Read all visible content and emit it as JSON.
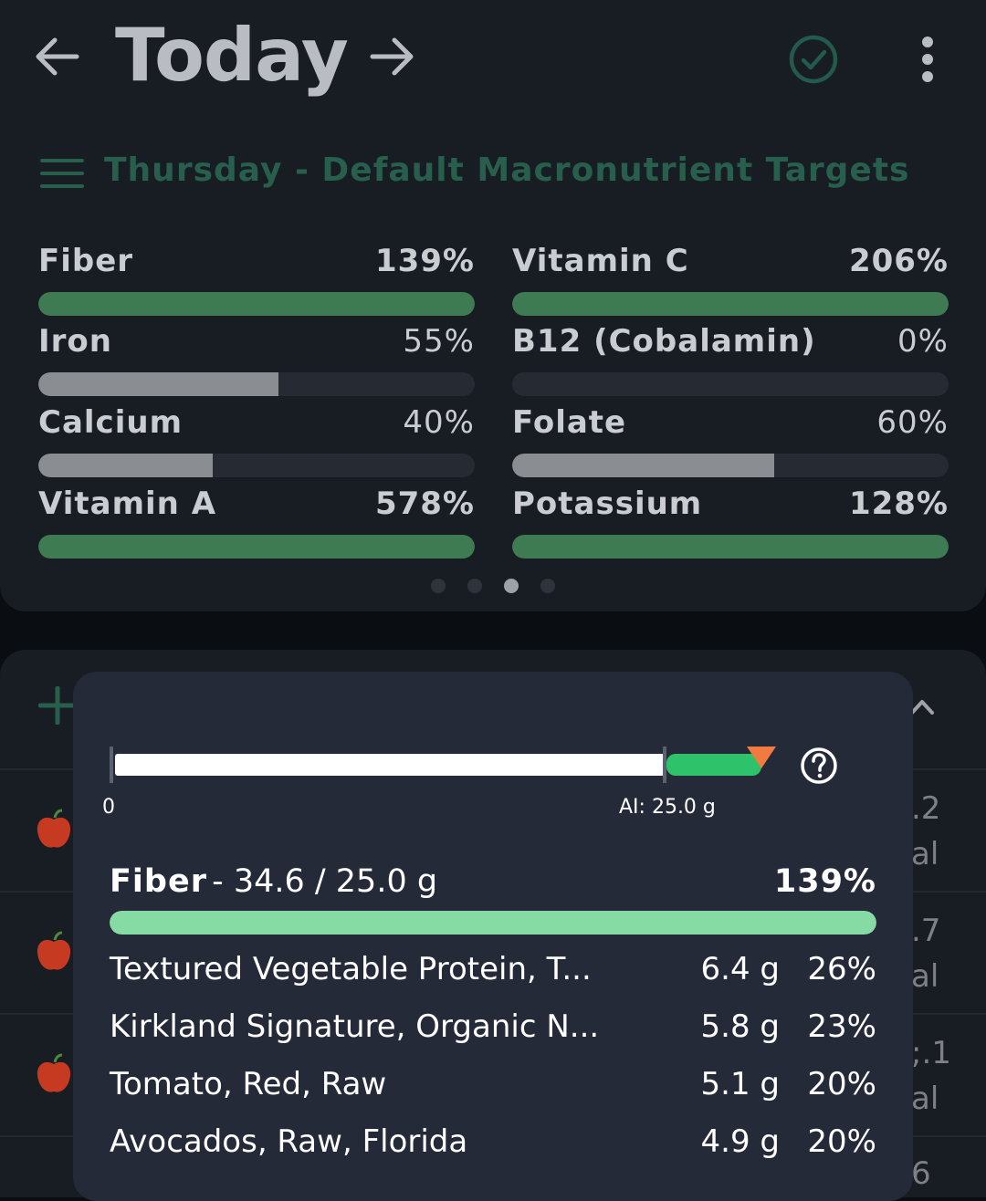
{
  "header": {
    "title": "Today"
  },
  "targets_label": "Thursday - Default Macronutrient Targets",
  "nutrients": [
    {
      "name": "Fiber",
      "percent_label": "139%",
      "fill": 1.0,
      "over": true
    },
    {
      "name": "Vitamin C",
      "percent_label": "206%",
      "fill": 1.0,
      "over": true
    },
    {
      "name": "Iron",
      "percent_label": "55%",
      "fill": 0.55,
      "over": false
    },
    {
      "name": "B12 (Cobalamin)",
      "percent_label": "0%",
      "fill": 0.0,
      "over": false
    },
    {
      "name": "Calcium",
      "percent_label": "40%",
      "fill": 0.4,
      "over": false
    },
    {
      "name": "Folate",
      "percent_label": "60%",
      "fill": 0.6,
      "over": false
    },
    {
      "name": "Vitamin A",
      "percent_label": "578%",
      "fill": 1.0,
      "over": true
    },
    {
      "name": "Potassium",
      "percent_label": "128%",
      "fill": 1.0,
      "over": true
    }
  ],
  "pager": {
    "count": 4,
    "active": 2
  },
  "lower_list": {
    "side_text": [
      ".2",
      "al",
      ".7",
      "al",
      ";.1",
      "al",
      "6"
    ]
  },
  "popup": {
    "range": {
      "zero_label": "0",
      "ai_label": "AI: 25.0 g",
      "ai_fraction": 0.72
    },
    "nutrient_name": "Fiber",
    "amount_label": "- 34.6 / 25.0 g",
    "percent_label": "139%",
    "foods": [
      {
        "name": "Textured Vegetable Protein, T...",
        "grams": "6.4 g",
        "percent": "26%"
      },
      {
        "name": "Kirkland Signature, Organic N...",
        "grams": "5.8 g",
        "percent": "23%"
      },
      {
        "name": "Tomato, Red, Raw",
        "grams": "5.1 g",
        "percent": "20%"
      },
      {
        "name": "Avocados, Raw, Florida",
        "grams": "4.9 g",
        "percent": "20%"
      }
    ]
  },
  "colors": {
    "accent_green": "#285e4c",
    "bar_full": "#3e7a52",
    "bar_partial": "#8a8d92",
    "popup_fill": "#86dba4",
    "marker_orange": "#f07a40"
  }
}
